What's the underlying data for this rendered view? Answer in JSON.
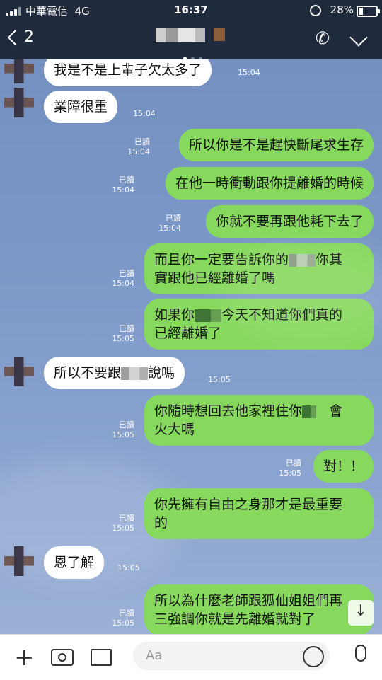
{
  "status": {
    "carrier": "中華電信",
    "network": "4G",
    "time": "16:37",
    "battery": "28%"
  },
  "header": {
    "back_label": "2",
    "icons": [
      "phone-icon",
      "chevron-down-icon"
    ]
  },
  "messages": [
    {
      "side": "in",
      "text": "我是不是上輩子欠太多了",
      "time": "15:04"
    },
    {
      "side": "in",
      "text": "業障很重",
      "time": "15:04"
    },
    {
      "side": "out",
      "read": "已讀",
      "time": "15:04",
      "text": "所以你是不是趕快斷尾求生存"
    },
    {
      "side": "out",
      "read": "已讀",
      "time": "15:04",
      "text": "在他一時衝動跟你提離婚的時候"
    },
    {
      "side": "out",
      "read": "已讀",
      "time": "15:04",
      "text": "你就不要再跟他耗下去了"
    },
    {
      "side": "out",
      "read": "已讀",
      "time": "15:04",
      "text_a": "而且你一定要告訴你的",
      "text_b": "你其",
      "text_c": "實跟他已經離婚了嗎"
    },
    {
      "side": "out",
      "read": "已讀",
      "time": "15:05",
      "text_a": "如果你",
      "text_b": "今天不知道你們真的",
      "text_c": "已經離婚了"
    },
    {
      "side": "in",
      "time": "15:05",
      "text_a": "所以不要跟",
      "text_b": "說嗎"
    },
    {
      "side": "out",
      "read": "已讀",
      "time": "15:05",
      "text_a": "你隨時想回去他家裡住你",
      "text_b": "會",
      "text_c": "火大嗎"
    },
    {
      "side": "out",
      "read": "已讀",
      "time": "15:05",
      "text": "對！！"
    },
    {
      "side": "out",
      "read": "已讀",
      "time": "15:05",
      "text_a": "你先擁有自由之身那才是最重要",
      "text_c": "的"
    },
    {
      "side": "in",
      "time": "15:05",
      "text": "恩了解"
    },
    {
      "side": "out",
      "read": "已讀",
      "time": "15:05",
      "text_a": "所以為什麼老師跟狐仙姐姐們再",
      "text_c": "三強調你就是先離婚就對了"
    }
  ],
  "input": {
    "placeholder": "Aa"
  }
}
